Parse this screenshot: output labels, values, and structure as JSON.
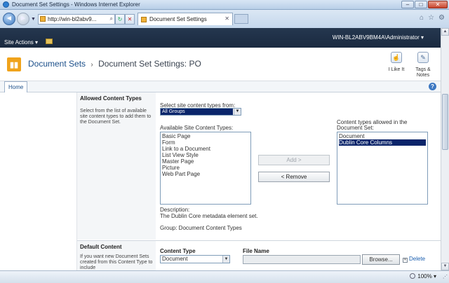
{
  "window": {
    "title": "Document Set Settings - Windows Internet Explorer",
    "min": "–",
    "max": "□",
    "close": "✕"
  },
  "browser": {
    "back": "◄",
    "forward": "►",
    "dropdown": "▼",
    "url": "http://win-bl2abv9...",
    "search_glyph": "⌕",
    "refresh_glyph": "↻",
    "stop_glyph": "✕",
    "tab_title": "Document Set Settings",
    "tab_close": "✕",
    "home_glyph": "⌂",
    "favorites_glyph": "☆",
    "tools_glyph": "⚙"
  },
  "sharepoint": {
    "site_actions": "Site Actions ▾",
    "user": "WIN-BL2ABV9BM4A\\Administrator ▾",
    "site_name": "Document Sets",
    "breadcrumb_sep": "›",
    "page_title": "Document Set Settings: PO",
    "i_like_it": "I Like It",
    "tags_notes": "Tags & Notes",
    "home_tab": "Home",
    "help": "?"
  },
  "allowed": {
    "title": "Allowed Content Types",
    "description": "Select from the list of available site content types to add them to the Document Set.",
    "select_from_label": "Select site content types from:",
    "group_value": "All Groups",
    "available_label": "Available Site Content Types:",
    "available": [
      "Basic Page",
      "Form",
      "Link to a Document",
      "List View Style",
      "Master Page",
      "Picture",
      "Web Part Page"
    ],
    "allowed_label_1": "Content types allowed in the",
    "allowed_label_2": "Document Set:",
    "allowed_items": [
      "Document",
      "Dublin Core Columns"
    ],
    "selected_index": 1,
    "add_button": "Add >",
    "remove_button": "< Remove",
    "description_label": "Description:",
    "description_value": "The Dublin Core metadata element set.",
    "group_line": "Group: Document Content Types"
  },
  "default_content": {
    "title": "Default Content",
    "description": "If you want new Document Sets created from this Content Type to include",
    "content_type_header": "Content Type",
    "file_name_header": "File Name",
    "content_type_value": "Document",
    "browse_button": "Browse...",
    "delete_link": "Delete"
  },
  "status": {
    "zoom": "100%",
    "zoom_arrow": "▾"
  },
  "colors": {
    "accent": "#0a246a",
    "brand_bar": "#1f3148",
    "site_icon": "#f0a31b"
  }
}
